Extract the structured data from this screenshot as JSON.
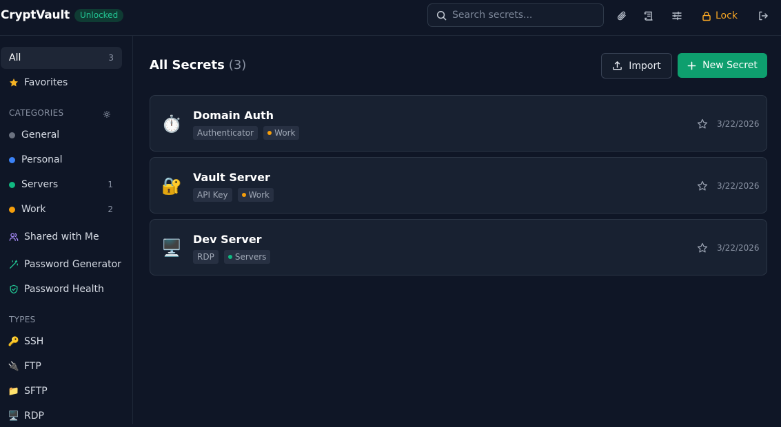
{
  "app": {
    "title": "CryptVault",
    "status_badge": "Unlocked"
  },
  "search": {
    "placeholder": "Search secrets..."
  },
  "topbar": {
    "icons": [
      "paperclip-icon",
      "scroll-icon",
      "sliders-icon"
    ],
    "lock_label": "Lock",
    "logout_icon": "logout-icon"
  },
  "sidebar": {
    "all": {
      "label": "All",
      "count": "3"
    },
    "favorites": {
      "label": "Favorites"
    },
    "categories_header": "CATEGORIES",
    "categories": [
      {
        "label": "General",
        "color": "#6b7280",
        "count": ""
      },
      {
        "label": "Personal",
        "color": "#3b82f6",
        "count": ""
      },
      {
        "label": "Servers",
        "color": "#10b981",
        "count": "1"
      },
      {
        "label": "Work",
        "color": "#f59e0b",
        "count": "2"
      }
    ],
    "shared": {
      "label": "Shared with Me"
    },
    "generator": {
      "label": "Password Generator"
    },
    "health": {
      "label": "Password Health"
    },
    "types_header": "TYPES",
    "types": [
      {
        "label": "SSH",
        "emoji": "🔑"
      },
      {
        "label": "FTP",
        "emoji": "🔌"
      },
      {
        "label": "SFTP",
        "emoji": "📁"
      },
      {
        "label": "RDP",
        "emoji": "🖥️"
      }
    ]
  },
  "main": {
    "title": "All Secrets",
    "count": "(3)",
    "import_label": "Import",
    "new_label": "New Secret"
  },
  "secrets": [
    {
      "emoji": "⏱️",
      "name": "Domain Auth",
      "type": "Authenticator",
      "category": "Work",
      "category_color": "#f59e0b",
      "date": "3/22/2026"
    },
    {
      "emoji": "🔐",
      "name": "Vault Server",
      "type": "API Key",
      "category": "Work",
      "category_color": "#f59e0b",
      "date": "3/22/2026"
    },
    {
      "emoji": "🖥️",
      "name": "Dev Server",
      "type": "RDP",
      "category": "Servers",
      "category_color": "#10b981",
      "date": "3/22/2026"
    }
  ]
}
